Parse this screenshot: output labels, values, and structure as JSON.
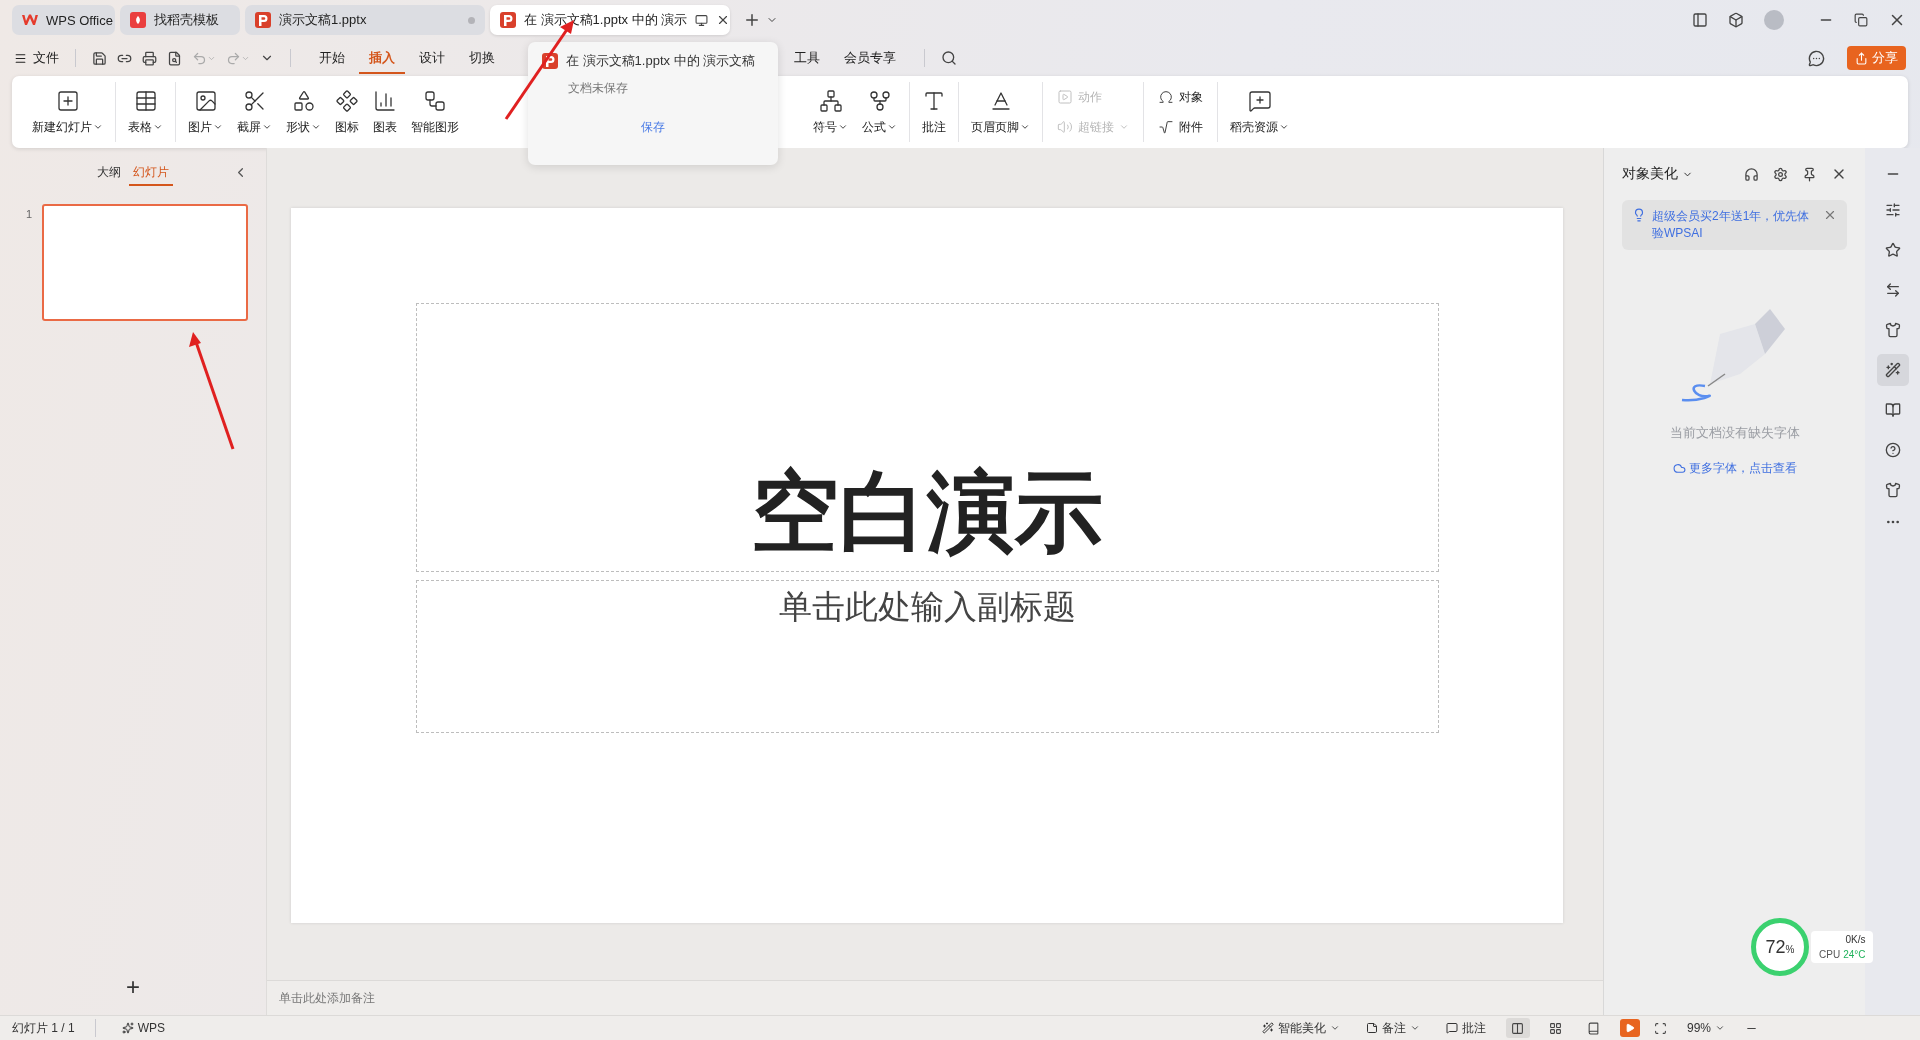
{
  "tabs": [
    {
      "label": "WPS Office",
      "kind": "home",
      "selected": false,
      "unsaved": false
    },
    {
      "label": "找稻壳模板",
      "kind": "docer",
      "selected": false,
      "unsaved": false
    },
    {
      "label": "演示文稿1.pptx",
      "kind": "doc",
      "selected": false,
      "unsaved": true
    },
    {
      "label": "在 演示文稿1.pptx 中的 演示",
      "kind": "doc",
      "selected": true,
      "unsaved": false
    }
  ],
  "menu": {
    "file": "文件",
    "tabs": [
      {
        "kind": "tab",
        "label": "开始",
        "selected": false
      },
      {
        "kind": "tab",
        "label": "插入",
        "selected": true
      },
      {
        "kind": "tab",
        "label": "设计",
        "selected": false
      },
      {
        "kind": "tab",
        "label": "切换",
        "selected": false
      },
      {
        "kind": "covered"
      },
      {
        "kind": "tab",
        "label": "工具",
        "selected": false
      },
      {
        "kind": "tab",
        "label": "会员专享",
        "selected": false
      }
    ],
    "share": "分享"
  },
  "ribbon": [
    {
      "kind": "large",
      "items": [
        {
          "label": "新建幻灯片",
          "menu": true,
          "disabled": false
        }
      ]
    },
    {
      "kind": "large",
      "items": [
        {
          "label": "表格",
          "menu": true,
          "disabled": false
        }
      ]
    },
    {
      "kind": "large",
      "items": [
        {
          "label": "图片",
          "menu": true,
          "disabled": false
        },
        {
          "label": "截屏",
          "menu": true,
          "disabled": false
        },
        {
          "label": "形状",
          "menu": true,
          "disabled": false
        },
        {
          "label": "图标",
          "menu": false,
          "disabled": false
        },
        {
          "label": "图表",
          "menu": false,
          "disabled": false
        },
        {
          "label": "智能图形",
          "menu": false,
          "disabled": false
        }
      ]
    },
    {
      "kind": "covered"
    },
    {
      "kind": "large",
      "items": [
        {
          "label": "符号",
          "menu": true,
          "disabled": false
        },
        {
          "label": "公式",
          "menu": true,
          "disabled": false
        }
      ]
    },
    {
      "kind": "large",
      "items": [
        {
          "label": "批注",
          "menu": false,
          "disabled": false
        }
      ]
    },
    {
      "kind": "large",
      "items": [
        {
          "label": "页眉页脚",
          "menu": true,
          "disabled": false
        }
      ]
    },
    {
      "kind": "stack",
      "items": [
        {
          "label": "动作",
          "menu": false,
          "disabled": true
        },
        {
          "label": "超链接",
          "menu": true,
          "disabled": true
        }
      ]
    },
    {
      "kind": "stack",
      "items": [
        {
          "label": "对象",
          "menu": false,
          "disabled": false
        },
        {
          "label": "附件",
          "menu": false,
          "disabled": false
        }
      ]
    },
    {
      "kind": "large",
      "items": [
        {
          "label": "稻壳资源",
          "menu": true,
          "disabled": false
        }
      ]
    }
  ],
  "tab_preview": {
    "title": "在 演示文稿1.pptx 中的 演示文稿",
    "status": "文档未保存",
    "button": "保存"
  },
  "slides_panel": {
    "tabs": [
      {
        "label": "大纲",
        "selected": false
      },
      {
        "label": "幻灯片",
        "selected": true
      }
    ],
    "slides": [
      {
        "number": "1",
        "selected": true
      }
    ],
    "add": "+"
  },
  "slide": {
    "title": "空白演示",
    "subtitle": "单击此处输入副标题"
  },
  "notes_placeholder": "单击此处添加备注",
  "side_panel": {
    "title": "对象美化",
    "promo": "超级会员买2年送1年，优先体验WPSAI",
    "message": "当前文档没有缺失字体",
    "link": "更多字体，点击查看"
  },
  "side_tools": [
    {
      "selected": false
    },
    {
      "selected": false
    },
    {
      "selected": false
    },
    {
      "selected": false
    },
    {
      "selected": true
    },
    {
      "selected": false
    },
    {
      "selected": false
    },
    {
      "selected": false
    }
  ],
  "status_bar": {
    "slide_count": "幻灯片 1 / 1",
    "brand": "WPS",
    "beautify": "智能美化",
    "notes": "备注",
    "comments": "批注",
    "views": [
      {
        "selected": true
      },
      {
        "selected": false
      },
      {
        "selected": false
      }
    ],
    "zoom": "99%"
  },
  "system_monitor": {
    "percent": "72",
    "unit": "%",
    "speed": "0K/s",
    "cpu_label": "CPU",
    "temp": "24°C"
  }
}
